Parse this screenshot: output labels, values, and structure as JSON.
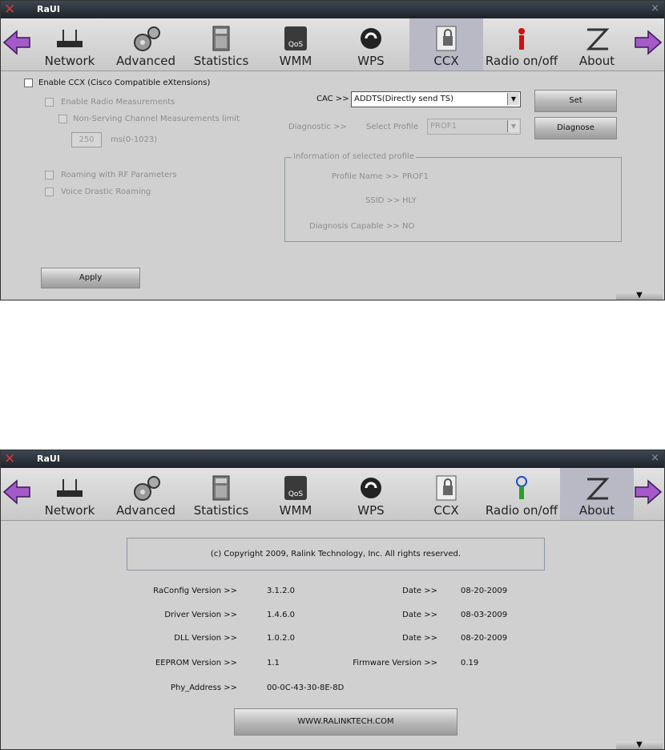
{
  "window": {
    "title": "RaUI",
    "close": "×"
  },
  "toolbar": {
    "items": [
      {
        "label": "Network",
        "icon": "router-icon"
      },
      {
        "label": "Advanced",
        "icon": "gears-icon"
      },
      {
        "label": "Statistics",
        "icon": "calculator-icon"
      },
      {
        "label": "WMM",
        "icon": "qos-icon"
      },
      {
        "label": "WPS",
        "icon": "wps-icon"
      },
      {
        "label": "CCX",
        "icon": "ccx-lock-icon"
      },
      {
        "label": "Radio on/off",
        "icon": "radio-icon"
      },
      {
        "label": "About",
        "icon": "about-icon"
      }
    ]
  },
  "ccx": {
    "enable_ccx": "Enable CCX (Cisco Compatible eXtensions)",
    "enable_radio_measurements": "Enable Radio Measurements",
    "non_serving_limit": "Non-Serving Channel Measurements limit",
    "limit_value": "250",
    "limit_unit": "ms(0-1023)",
    "roaming_rf": "Roaming with RF Parameters",
    "voice_drastic": "Voice Drastic Roaming",
    "apply": "Apply",
    "cac_label": "CAC >>",
    "cac_value": "ADDTS(Directly send TS)",
    "set": "Set",
    "diagnostic_label": "Diagnostic >>",
    "select_profile_label": "Select Profile",
    "select_profile_value": "PROF1",
    "diagnose": "Diagnose",
    "group_title": "Information of selected profile",
    "profile_name_label": "Profile Name >>",
    "profile_name_value": "PROF1",
    "ssid_label": "SSID >>",
    "ssid_value": "HLY",
    "diag_capable_label": "Diagnosis Capable >>",
    "diag_capable_value": "NO"
  },
  "about": {
    "copyright": "(c) Copyright 2009, Ralink Technology, Inc.  All rights reserved.",
    "raconfig_label": "RaConfig Version >>",
    "raconfig_value": "3.1.2.0",
    "driver_label": "Driver Version >>",
    "driver_value": "1.4.6.0",
    "dll_label": "DLL Version >>",
    "dll_value": "1.0.2.0",
    "eeprom_label": "EEPROM Version >>",
    "eeprom_value": "1.1",
    "phy_label": "Phy_Address >>",
    "phy_value": "00-0C-43-30-8E-8D",
    "date_label": "Date >>",
    "date1": "08-20-2009",
    "date2": "08-03-2009",
    "date3": "08-20-2009",
    "firmware_label": "Firmware Version >>",
    "firmware_value": "0.19",
    "website": "WWW.RALINKTECH.COM"
  }
}
